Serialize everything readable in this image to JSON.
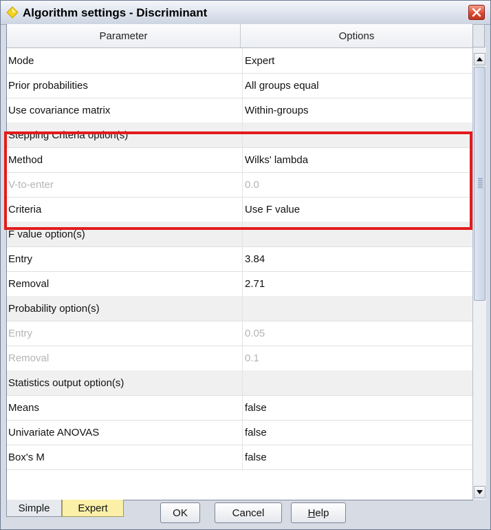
{
  "window": {
    "title": "Algorithm settings - Discriminant"
  },
  "table": {
    "headers": [
      "Parameter",
      "Options"
    ],
    "rows": [
      {
        "param": "Mode",
        "value": "Expert",
        "type": "normal"
      },
      {
        "param": "Prior probabilities",
        "value": "All groups equal",
        "type": "normal"
      },
      {
        "param": "Use covariance matrix",
        "value": "Within-groups",
        "type": "normal"
      },
      {
        "param": "Stepping Criteria option(s)",
        "value": "",
        "type": "section"
      },
      {
        "param": "Method",
        "value": "Wilks' lambda",
        "type": "normal"
      },
      {
        "param": "V-to-enter",
        "value": "0.0",
        "type": "disabled"
      },
      {
        "param": "Criteria",
        "value": "Use F value",
        "type": "normal"
      },
      {
        "param": "F value option(s)",
        "value": "",
        "type": "section"
      },
      {
        "param": "Entry",
        "value": "3.84",
        "type": "normal"
      },
      {
        "param": "Removal",
        "value": "2.71",
        "type": "normal"
      },
      {
        "param": "Probability option(s)",
        "value": "",
        "type": "section"
      },
      {
        "param": "Entry",
        "value": "0.05",
        "type": "disabled"
      },
      {
        "param": "Removal",
        "value": "0.1",
        "type": "disabled"
      },
      {
        "param": "Statistics output option(s)",
        "value": "",
        "type": "section"
      },
      {
        "param": "Means",
        "value": "false",
        "type": "normal"
      },
      {
        "param": "Univariate ANOVAS",
        "value": "false",
        "type": "normal"
      },
      {
        "param": "Box's M",
        "value": "false",
        "type": "normal"
      }
    ]
  },
  "tabs": [
    {
      "label": "Simple",
      "selected": false
    },
    {
      "label": "Expert",
      "selected": true
    }
  ],
  "buttons": {
    "ok": "OK",
    "cancel": "Cancel",
    "help_mnemonic": "H",
    "help_rest": "elp"
  },
  "colors": {
    "highlight": "#e31b1b",
    "selected_tab": "#fbf0a8",
    "title_icon": "#f5d21e"
  },
  "icons": [
    "diamond-icon",
    "close-icon",
    "scroll-up-icon",
    "scroll-down-icon"
  ]
}
